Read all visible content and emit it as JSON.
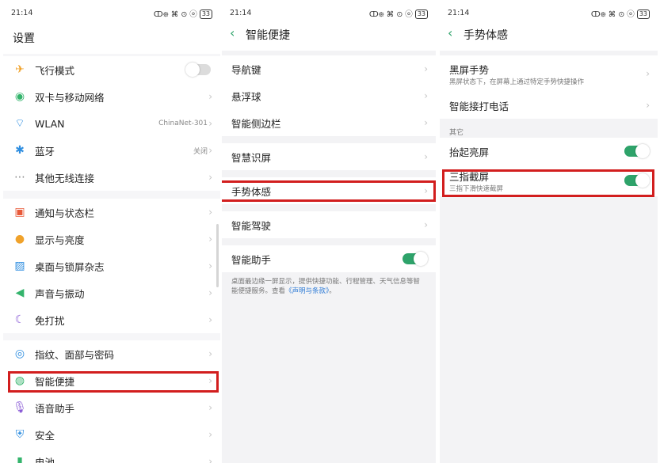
{
  "status": {
    "time": "21:14",
    "signal": "ↀ᪥ ⌘ ⊙ ⓞ",
    "battery": "33"
  },
  "panel1": {
    "title": "设置",
    "items": [
      {
        "label": "飞行模式",
        "icon": "airplane-icon",
        "glyph": "✈",
        "color": "#f0a22b",
        "type": "toggle",
        "on": false
      },
      {
        "label": "双卡与移动网络",
        "icon": "globe-icon",
        "glyph": "◉",
        "color": "#34b46c",
        "type": "chevron"
      },
      {
        "label": "WLAN",
        "icon": "wifi-icon",
        "glyph": "⌔",
        "color": "#2f8ee0",
        "type": "chevron",
        "value": "ChinaNet-301"
      },
      {
        "label": "蓝牙",
        "icon": "bluetooth-icon",
        "glyph": "✱",
        "color": "#2f8ee0",
        "type": "chevron",
        "value": "关闭"
      },
      {
        "label": "其他无线连接",
        "icon": "more-icon",
        "glyph": "⋯",
        "color": "#888",
        "type": "chevron"
      },
      {
        "label": "通知与状态栏",
        "icon": "notification-icon",
        "glyph": "▣",
        "color": "#e85a3a",
        "type": "chevron"
      },
      {
        "label": "显示与亮度",
        "icon": "brightness-icon",
        "glyph": "●",
        "color": "#f0a22b",
        "type": "chevron"
      },
      {
        "label": "桌面与锁屏杂志",
        "icon": "wallpaper-icon",
        "glyph": "▨",
        "color": "#2f8ee0",
        "type": "chevron"
      },
      {
        "label": "声音与振动",
        "icon": "speaker-icon",
        "glyph": "◀",
        "color": "#34b46c",
        "type": "chevron"
      },
      {
        "label": "免打扰",
        "icon": "moon-icon",
        "glyph": "☾",
        "color": "#8a5bd6",
        "type": "chevron"
      },
      {
        "label": "指纹、面部与密码",
        "icon": "fingerprint-icon",
        "glyph": "◎",
        "color": "#2f8ee0",
        "type": "chevron"
      },
      {
        "label": "智能便捷",
        "icon": "smart-icon",
        "glyph": "◍",
        "color": "#34b46c",
        "type": "chevron"
      },
      {
        "label": "语音助手",
        "icon": "microphone-icon",
        "glyph": "🎙",
        "color": "#8a5bd6",
        "type": "chevron"
      },
      {
        "label": "安全",
        "icon": "shield-icon",
        "glyph": "⛨",
        "color": "#2f8ee0",
        "type": "chevron"
      },
      {
        "label": "电池",
        "icon": "battery-icon",
        "glyph": "▮",
        "color": "#34b46c",
        "type": "chevron"
      }
    ]
  },
  "panel2": {
    "title": "智能便捷",
    "items": [
      {
        "label": "导航键"
      },
      {
        "label": "悬浮球"
      },
      {
        "label": "智能侧边栏"
      },
      {
        "label": "智慧识屏"
      },
      {
        "label": "手势体感"
      },
      {
        "label": "智能驾驶"
      }
    ],
    "assistant": {
      "label": "智能助手",
      "on": true
    },
    "footnote": "桌面最边缘一屏显示，提供快捷功能、行程管理、天气信息等智能便捷服务。查看",
    "footnote_link": "《声明与条款》",
    "footnote_end": "。"
  },
  "panel3": {
    "title": "手势体感",
    "black_gesture": {
      "label": "黑屏手势",
      "sub": "黑屏状态下，在屏幕上通过特定手势快捷操作"
    },
    "smart_answer": {
      "label": "智能接打电话"
    },
    "section": "其它",
    "raise": {
      "label": "抬起亮屏",
      "on": true
    },
    "three_finger": {
      "label": "三指截屏",
      "sub": "三指下滑快速截屏",
      "on": true
    }
  },
  "accent": "#2ea36a",
  "highlight": "#d21e1e"
}
